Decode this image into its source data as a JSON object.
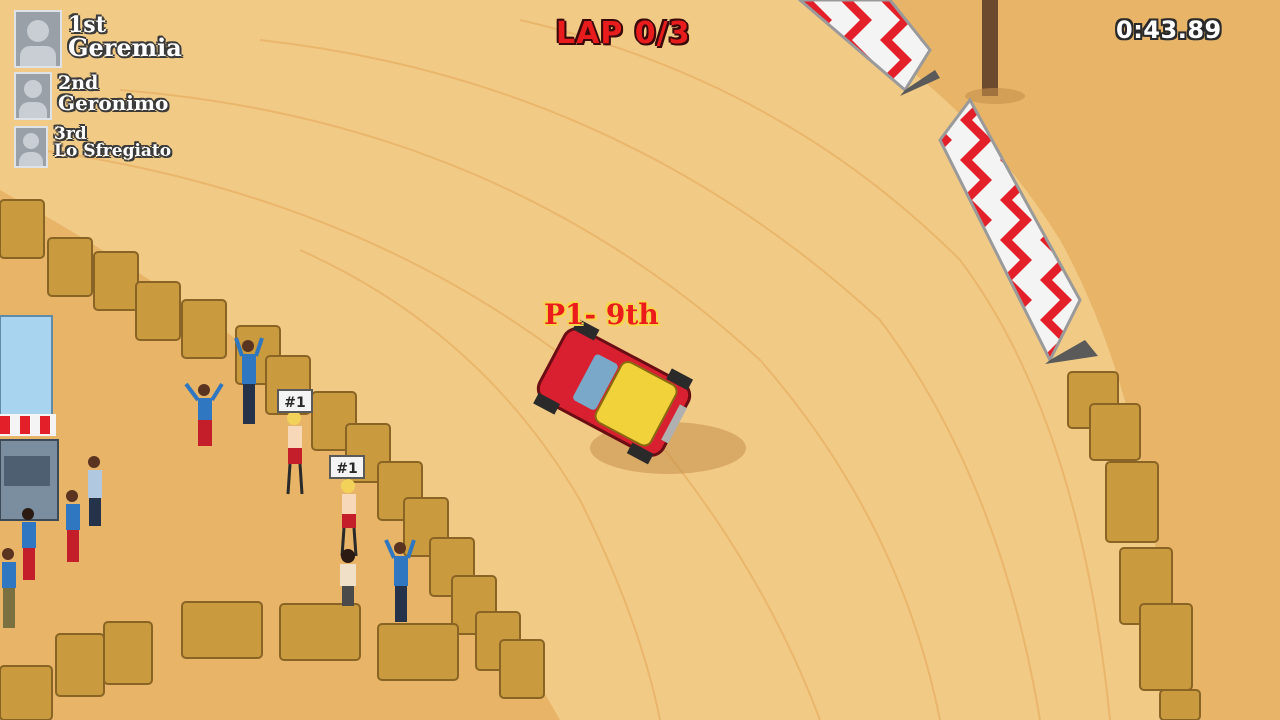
{
  "hud": {
    "lap_text": "LAP 0/3",
    "timer": "0:43.89",
    "player_tag": "P1- 9th"
  },
  "standings": [
    {
      "position": "1st",
      "name": "Geremia"
    },
    {
      "position": "2nd",
      "name": "Geronimo"
    },
    {
      "position": "3rd",
      "name": "Lo Sfregiato"
    }
  ],
  "signs": [
    "#1",
    "#1"
  ],
  "colors": {
    "sand": "#e8b468",
    "track": "#f1cb86",
    "lap_red": "#e81c1c",
    "car_body": "#d82030",
    "car_roof": "#f2d23a",
    "barrier_red": "#e3202a",
    "hay": "#c99a3e"
  },
  "icons": {
    "avatar": "person-silhouette-icon",
    "car": "rally-car-icon",
    "barrier": "chevron-barrier-icon"
  }
}
